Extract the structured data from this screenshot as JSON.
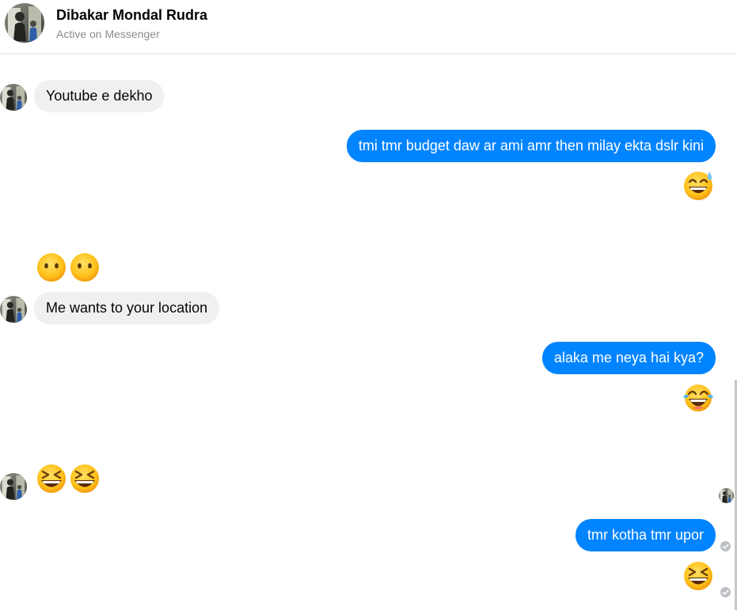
{
  "header": {
    "name": "Dibakar Mondal Rudra",
    "status": "Active on Messenger"
  },
  "messages": [
    {
      "direction": "incoming",
      "type": "text",
      "text": "Youtube e dekho"
    },
    {
      "direction": "outgoing",
      "type": "text",
      "text": "tmi tmr budget daw ar ami amr then milay ekta dslr kini"
    },
    {
      "direction": "outgoing",
      "type": "emoji",
      "emoji": "grinning-face-with-sweat"
    },
    {
      "direction": "incoming",
      "type": "emoji",
      "emoji": "face-without-mouth"
    },
    {
      "direction": "incoming",
      "type": "emoji",
      "emoji": "face-without-mouth"
    },
    {
      "direction": "incoming",
      "type": "text",
      "text": "Me wants to your location"
    },
    {
      "direction": "outgoing",
      "type": "text",
      "text": "alaka me neya hai kya?"
    },
    {
      "direction": "outgoing",
      "type": "emoji",
      "emoji": "face-with-tears-of-joy"
    },
    {
      "direction": "incoming",
      "type": "emoji",
      "emoji": "grinning-squinting-face"
    },
    {
      "direction": "incoming",
      "type": "emoji",
      "emoji": "grinning-squinting-face"
    },
    {
      "direction": "outgoing",
      "type": "text",
      "text": "tmr kotha tmr upor"
    },
    {
      "direction": "outgoing",
      "type": "emoji",
      "emoji": "grinning-squinting-face"
    }
  ],
  "colors": {
    "outgoing_bubble": "#0084ff",
    "incoming_bubble": "#f0f0f0",
    "status_text": "#8a8d91"
  }
}
